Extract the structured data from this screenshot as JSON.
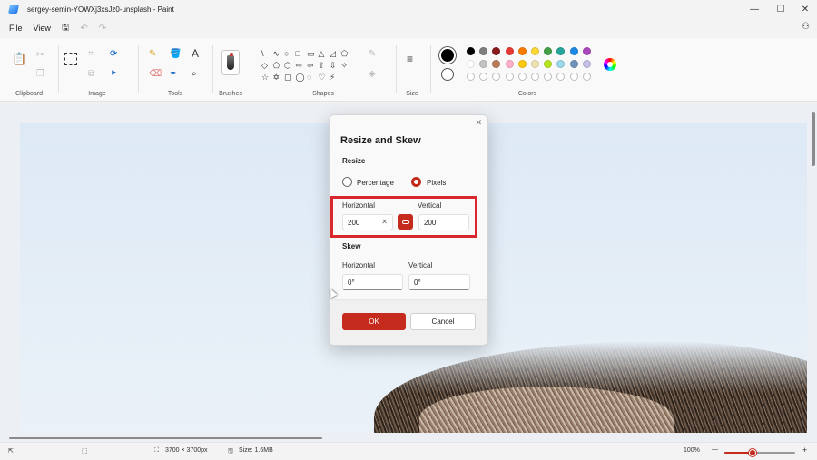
{
  "window": {
    "title": "sergey-semin-YOWXj3xsJz0-unsplash - Paint",
    "minimize_glyph": "—",
    "maximize_glyph": "☐",
    "close_glyph": "✕"
  },
  "menu": {
    "file": "File",
    "view": "View",
    "save_glyph": "🖫",
    "undo_glyph": "↶",
    "redo_glyph": "↷",
    "share_glyph": "⚇"
  },
  "ribbon": {
    "groups": {
      "clipboard": "Clipboard",
      "image": "Image",
      "tools": "Tools",
      "brushes": "Brushes",
      "shapes": "Shapes",
      "size": "Size",
      "colors": "Colors"
    },
    "shape_glyphs": [
      "\\",
      "∿",
      "○",
      "□",
      "▭",
      "△",
      "◿",
      "⬠",
      "◇",
      "⬠",
      "⬡",
      "⇨",
      "⇦",
      "⇧",
      "⇩",
      "✧",
      "☆",
      "✡",
      "▢",
      "◯",
      "◌",
      "♡",
      "⚡"
    ],
    "colors_row1": [
      "#000000",
      "#7f7f7f",
      "#8b1a1a",
      "#e53935",
      "#f57c00",
      "#fdd835",
      "#43a047",
      "#26a69a",
      "#1e88e5",
      "#ab47bc"
    ],
    "colors_row2": [
      "#ffffff",
      "#c3c3c3",
      "#b97a57",
      "#ffaec9",
      "#ffc90e",
      "#efe4b0",
      "#b5e61d",
      "#99d9ea",
      "#7092be",
      "#c8bfe7"
    ]
  },
  "dialog": {
    "close_glyph": "✕",
    "title": "Resize and Skew",
    "resize_heading": "Resize",
    "radio_percentage": "Percentage",
    "radio_pixels": "Pixels",
    "selected_mode": "Pixels",
    "horizontal_label": "Horizontal",
    "vertical_label": "Vertical",
    "resize_horizontal_value": "200",
    "resize_vertical_value": "200",
    "clear_glyph": "✕",
    "skew_heading": "Skew",
    "skew_horizontal_label": "Horizontal",
    "skew_vertical_label": "Vertical",
    "skew_horizontal_value": "0°",
    "skew_vertical_value": "0°",
    "ok_label": "OK",
    "cancel_label": "Cancel"
  },
  "status": {
    "pointer_glyph": "⇱",
    "selection_glyph": "⬚",
    "dimensions_glyph": "⛶",
    "dimensions": "3700 × 3700px",
    "size_glyph": "🖫",
    "size": "Size: 1.6MB",
    "zoom": "100%",
    "zoom_out": "—",
    "zoom_in": "+",
    "zoom_fraction": 0.4
  },
  "colors": {
    "accent": "#c42b1c",
    "highlight": "#d9272e"
  }
}
